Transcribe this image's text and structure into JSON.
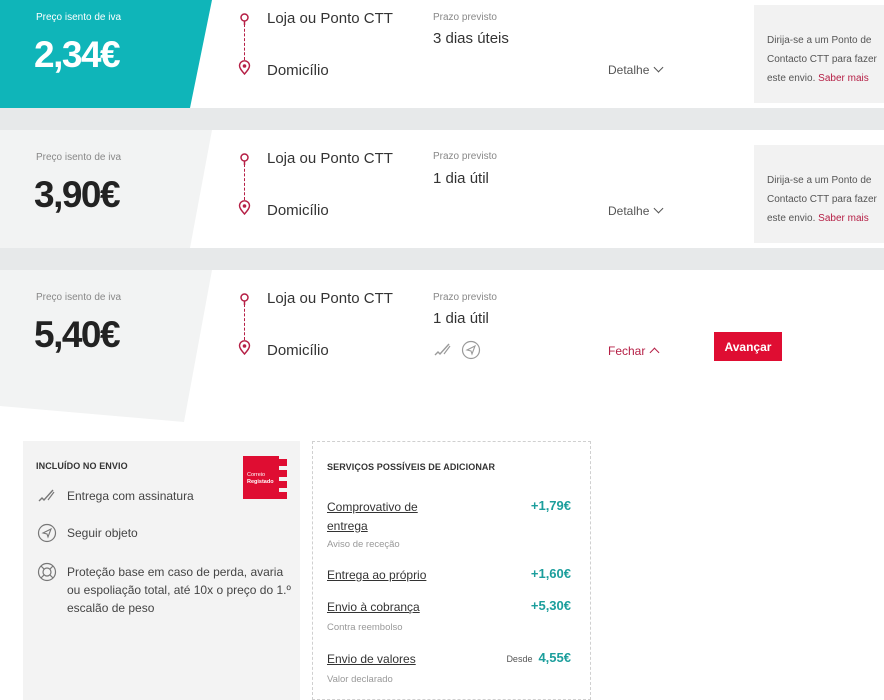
{
  "colors": {
    "teal": "#0fb5b9",
    "ctt_red": "#df0d32",
    "accent_red": "#b51f45",
    "service_price": "#1b9e9c"
  },
  "options": [
    {
      "price_label": "Preço isento de iva",
      "price": "2,34€",
      "origin": "Loja ou Ponto CTT",
      "destination": "Domicílio",
      "prazo_label": "Prazo previsto",
      "prazo": "3 dias úteis",
      "detail_label": "Detalhe",
      "note_text": "Dirija-se a um Ponto de Contacto CTT para fazer este envio.",
      "note_link": "Saber mais"
    },
    {
      "price_label": "Preço isento de iva",
      "price": "3,90€",
      "origin": "Loja ou Ponto CTT",
      "destination": "Domicílio",
      "prazo_label": "Prazo previsto",
      "prazo": "1 dia útil",
      "detail_label": "Detalhe",
      "note_text": "Dirija-se a um Ponto de Contacto CTT para fazer este envio.",
      "note_link": "Saber mais"
    },
    {
      "price_label": "Preço isento de iva",
      "price": "5,40€",
      "origin": "Loja ou Ponto CTT",
      "destination": "Domicílio",
      "prazo_label": "Prazo previsto",
      "prazo": "1 dia útil",
      "close_label": "Fechar",
      "advance_label": "Avançar"
    }
  ],
  "included": {
    "title": "INCLUÍDO NO ENVIO",
    "stamp_line1": "Correio",
    "stamp_line2": "Registado",
    "items": [
      {
        "icon": "signature-icon",
        "text": "Entrega com assinatura"
      },
      {
        "icon": "tracking-icon",
        "text": "Seguir objeto"
      },
      {
        "icon": "lifebuoy-icon",
        "text": "Proteção base em caso de perda, avaria ou espoliação total, até 10x o preço do 1.º escalão de peso"
      }
    ]
  },
  "services": {
    "title": "SERVIÇOS POSSÍVEIS DE ADICIONAR",
    "items": [
      {
        "name": "Comprovativo de entrega",
        "sub": "Aviso de receção",
        "from": "",
        "price": "+1,79€"
      },
      {
        "name": "Entrega ao próprio",
        "sub": "",
        "from": "",
        "price": "+1,60€"
      },
      {
        "name": "Envio à cobrança",
        "sub": "Contra reembolso",
        "from": "",
        "price": "+5,30€"
      },
      {
        "name": "Envio de valores",
        "sub": "Valor declarado",
        "from": "Desde",
        "price": "4,55€"
      }
    ]
  }
}
